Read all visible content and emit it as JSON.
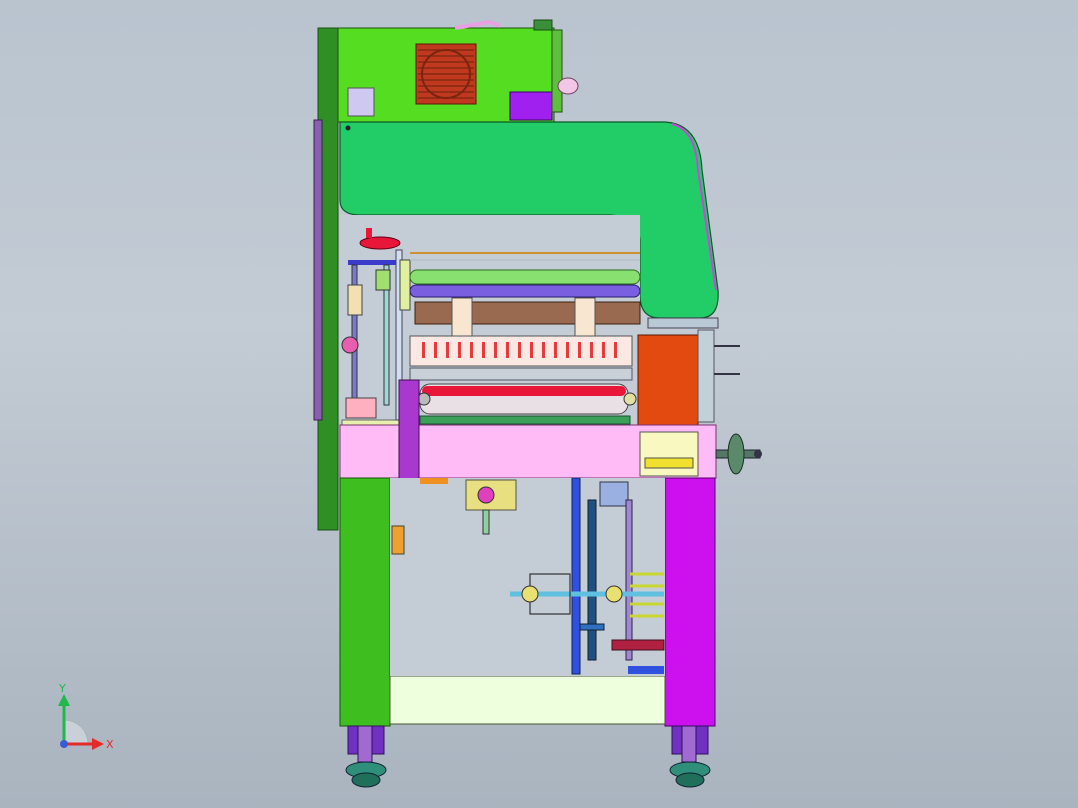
{
  "viewport": {
    "background_top": "#b9c4cf",
    "background_bottom": "#a9b4bf",
    "view": "front",
    "model": "machine-assembly"
  },
  "triad": {
    "x_label": "X",
    "y_label": "Y",
    "x_color": "#e52a2a",
    "y_color": "#1fb84a",
    "origin_color": "#3a5bd6"
  },
  "colors": {
    "top_box": "#55dd22",
    "arch": "#22cc66",
    "left_leg": "#3fbf1f",
    "right_leg": "#cc11ee",
    "pink_beam": "#ffbbf5",
    "bottom_bar": "#eeffdd",
    "orange_block": "#e24a10",
    "roller_red": "#e8173a",
    "vent": "#c0391f",
    "purple_panel": "#a020f0"
  }
}
